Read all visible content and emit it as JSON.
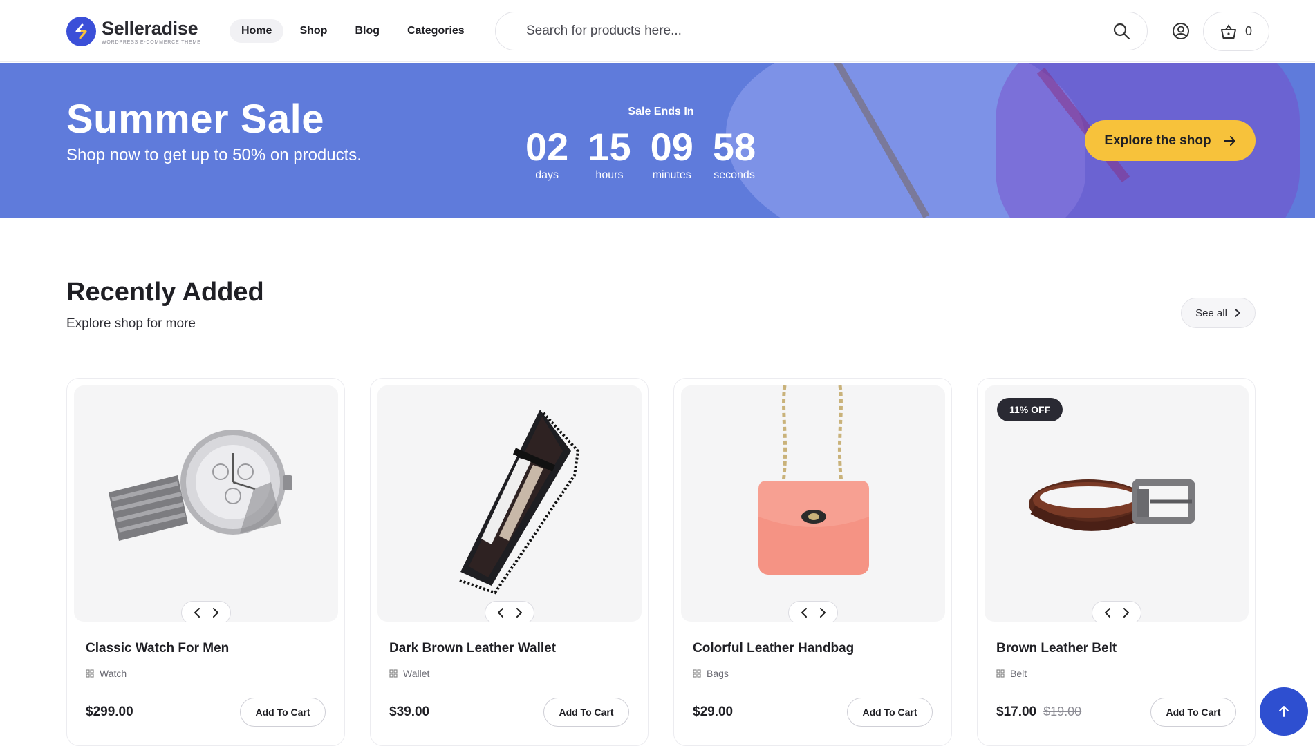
{
  "header": {
    "brand": "Selleradise",
    "tagline": "WordPress E-Commerce Theme",
    "nav": [
      {
        "label": "Home",
        "active": true
      },
      {
        "label": "Shop",
        "active": false
      },
      {
        "label": "Blog",
        "active": false
      },
      {
        "label": "Categories",
        "active": false
      }
    ],
    "search_placeholder": "Search for products here...",
    "cart_count": "0",
    "icons": {
      "search": "search-icon",
      "user": "user-icon",
      "cart": "basket-icon"
    }
  },
  "banner": {
    "title": "Summer Sale",
    "subtitle": "Shop now to get up to 50% on products.",
    "sale_ends_label": "Sale Ends In",
    "countdown": [
      {
        "value": "02",
        "label": "days"
      },
      {
        "value": "15",
        "label": "hours"
      },
      {
        "value": "09",
        "label": "minutes"
      },
      {
        "value": "58",
        "label": "seconds"
      }
    ],
    "cta": "Explore the shop",
    "background_color": "#5f7bdb",
    "cta_color": "#f7c23b"
  },
  "section": {
    "title": "Recently Added",
    "subtitle": "Explore shop for more",
    "see_all": "See all"
  },
  "products": [
    {
      "name": "Classic Watch For Men",
      "category": "Watch",
      "price": "$299.00",
      "old_price": "",
      "badge": "",
      "button": "Add To Cart",
      "image": "watch"
    },
    {
      "name": "Dark Brown Leather Wallet",
      "category": "Wallet",
      "price": "$39.00",
      "old_price": "",
      "badge": "",
      "button": "Add To Cart",
      "image": "wallet"
    },
    {
      "name": "Colorful Leather Handbag",
      "category": "Bags",
      "price": "$29.00",
      "old_price": "",
      "badge": "",
      "button": "Add To Cart",
      "image": "handbag"
    },
    {
      "name": "Brown Leather Belt",
      "category": "Belt",
      "price": "$17.00",
      "old_price": "$19.00",
      "badge": "11% OFF",
      "button": "Add To Cart",
      "image": "belt"
    }
  ],
  "colors": {
    "accent": "#3b4fd8",
    "text": "#1f1f24",
    "back_to_top": "#2e4fd0"
  }
}
